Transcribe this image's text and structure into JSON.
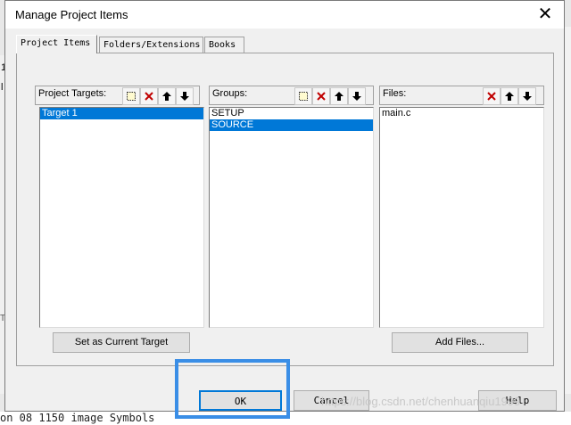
{
  "dialog": {
    "title": "Manage Project Items",
    "close_label": "✕"
  },
  "tabs": [
    {
      "label": "Project Items",
      "active": true
    },
    {
      "label": "Folders/Extensions",
      "active": false
    },
    {
      "label": "Books",
      "active": false
    }
  ],
  "targets": {
    "label": "Project Targets:",
    "items": [
      {
        "text": "Target 1",
        "selected": true
      }
    ],
    "set_current_label": "Set as Current Target"
  },
  "groups": {
    "label": "Groups:",
    "items": [
      {
        "text": "SETUP",
        "selected": false
      },
      {
        "text": "SOURCE",
        "selected": true
      }
    ]
  },
  "files": {
    "label": "Files:",
    "items": [
      {
        "text": "main.c",
        "selected": false
      }
    ],
    "add_label": "Add Files..."
  },
  "buttons": {
    "ok": "OK",
    "cancel": "Cancel",
    "help": "Help"
  },
  "background": {
    "left_chars": [
      "1",
      "l"
    ],
    "left_partial": "Te",
    "bottom_text": "on 08 1150 image Symbols",
    "watermark": "https://blog.csdn.net/chenhuanqiu1999"
  },
  "colors": {
    "selection": "#0078d7",
    "highlight": "#3a8ee6",
    "delete_icon": "#c00000"
  }
}
